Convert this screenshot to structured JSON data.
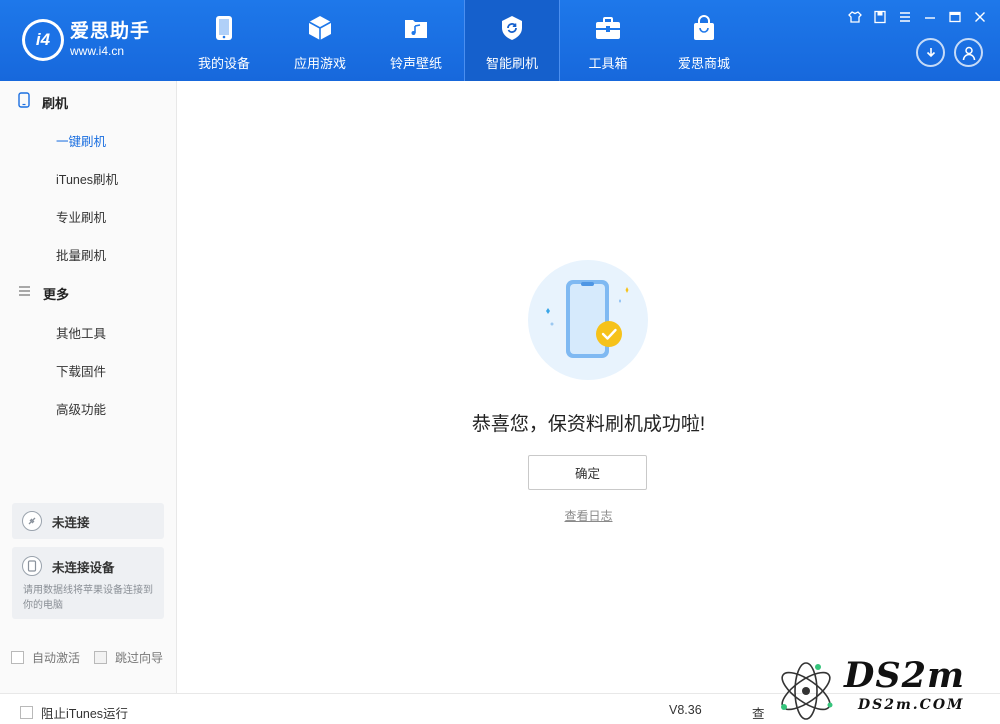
{
  "app": {
    "name": "爱思助手",
    "url": "www.i4.cn",
    "logo_text": "i4"
  },
  "nav": {
    "items": [
      {
        "label": "我的设备",
        "icon": "phone-icon"
      },
      {
        "label": "应用游戏",
        "icon": "cube-icon"
      },
      {
        "label": "铃声壁纸",
        "icon": "music-folder-icon"
      },
      {
        "label": "智能刷机",
        "icon": "refresh-shield-icon"
      },
      {
        "label": "工具箱",
        "icon": "toolbox-icon"
      },
      {
        "label": "爱思商城",
        "icon": "shopping-bag-icon"
      }
    ],
    "active_index": 3
  },
  "sidebar": {
    "groups": [
      {
        "label": "刷机",
        "icon": "phone-outline-icon"
      },
      {
        "label": "更多",
        "icon": "menu-lines-icon"
      }
    ],
    "flash_items": [
      "一键刷机",
      "iTunes刷机",
      "专业刷机",
      "批量刷机"
    ],
    "more_items": [
      "其他工具",
      "下载固件",
      "高级功能"
    ],
    "active_item": "一键刷机",
    "connection_status": "未连接",
    "device_status": "未连接设备",
    "device_hint": "请用数据线将苹果设备连接到你的电脑",
    "auto_activate": "自动激活",
    "skip_guide": "跳过向导"
  },
  "main": {
    "success_message": "恭喜您，保资料刷机成功啦!",
    "confirm_button": "确定",
    "view_log": "查看日志"
  },
  "bottom": {
    "block_itunes": "阻止iTunes运行",
    "version": "V8.36",
    "partial_text": "查"
  },
  "watermark": {
    "big": "DS2m",
    "small": "DS2m.COM"
  },
  "colors": {
    "header_blue": "#1e78ea",
    "active_blue": "#1b6fe0",
    "success_yellow": "#f6c21a"
  }
}
